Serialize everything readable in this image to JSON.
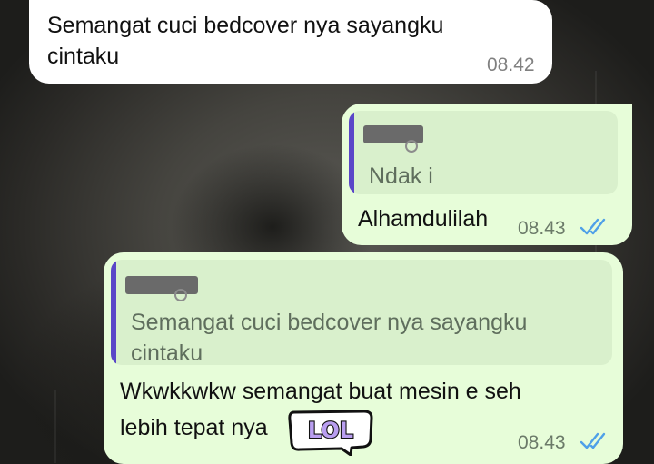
{
  "messages": {
    "m1": {
      "text_line1": "Semangat cuci bedcover nya sayangku",
      "text_line2": "cintaku",
      "time": "08.42"
    },
    "m2": {
      "quote_text": "Ndak i",
      "text": "Alhamdulilah",
      "time": "08.43",
      "status": "read"
    },
    "m3": {
      "quote_line1": "Semangat cuci bedcover nya sayangku",
      "quote_line2": "cintaku",
      "text_line1": "Wkwkkwkw semangat buat mesin e seh",
      "text_line2": "lebih tepat nya",
      "sticker": "LOL",
      "time": "08.43",
      "status": "read"
    }
  },
  "colors": {
    "incoming_bubble": "#ffffff",
    "outgoing_bubble": "#e7fdd9",
    "quote_bar": "#5a46c8",
    "read_ticks": "#4fa0e8",
    "sticker_fill": "#b99ef0"
  },
  "icons": {
    "read_receipt": "double-check-icon",
    "sticker": "lol-sticker-icon"
  }
}
